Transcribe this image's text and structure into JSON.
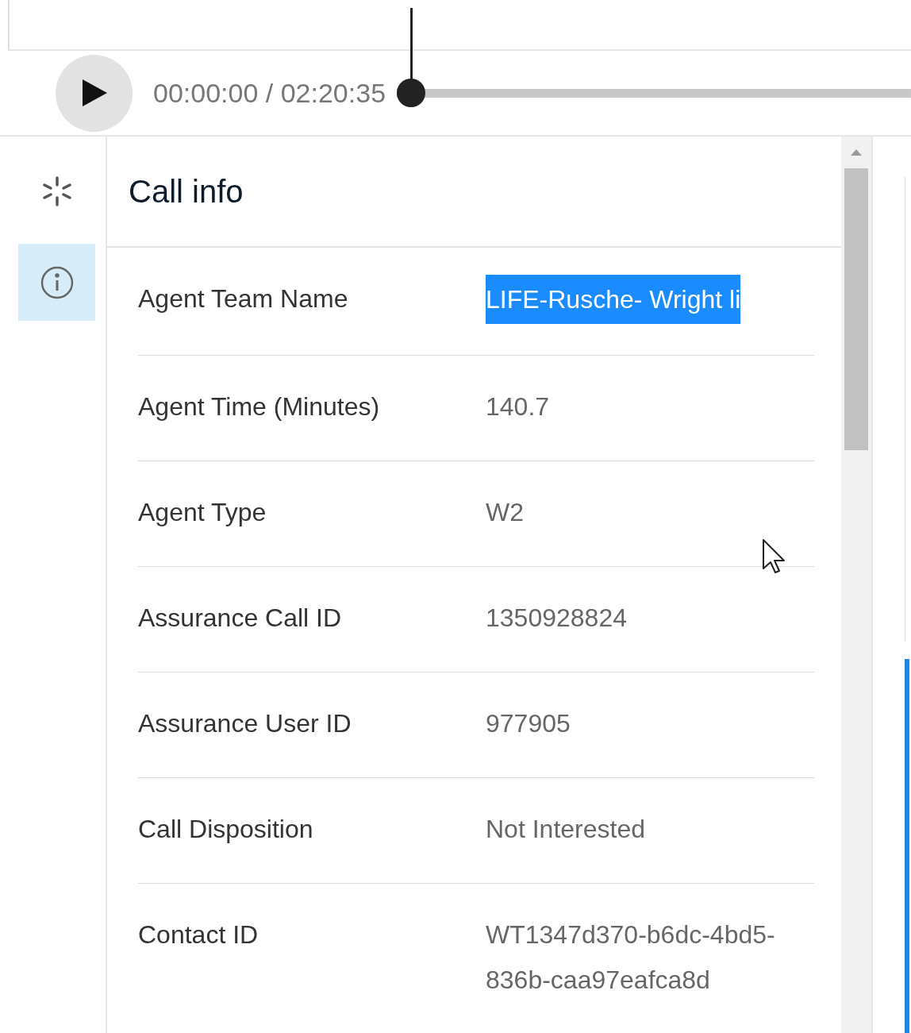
{
  "player": {
    "time": "00:00:00 / 02:20:35",
    "level": 0
  },
  "sidebar": {
    "items": [
      {
        "kind": "sparkle",
        "selected": false
      },
      {
        "kind": "info",
        "selected": true
      }
    ]
  },
  "panel": {
    "title": "Call info",
    "rows": [
      {
        "label": "Agent Team Name",
        "value": "LIFE-Rusche- Wright li",
        "highlighted": true
      },
      {
        "label": "Agent Time (Minutes)",
        "value": "140.7",
        "highlighted": false
      },
      {
        "label": "Agent Type",
        "value": "W2",
        "highlighted": false
      },
      {
        "label": "Assurance Call ID",
        "value": "1350928824",
        "highlighted": false
      },
      {
        "label": "Assurance User ID",
        "value": "977905",
        "highlighted": false
      },
      {
        "label": "Call Disposition",
        "value": "Not Interested",
        "highlighted": false
      },
      {
        "label": "Contact ID",
        "value": "WT1347d370-b6dc-4bd5-836b-caa97eafca8d",
        "highlighted": false
      }
    ]
  }
}
